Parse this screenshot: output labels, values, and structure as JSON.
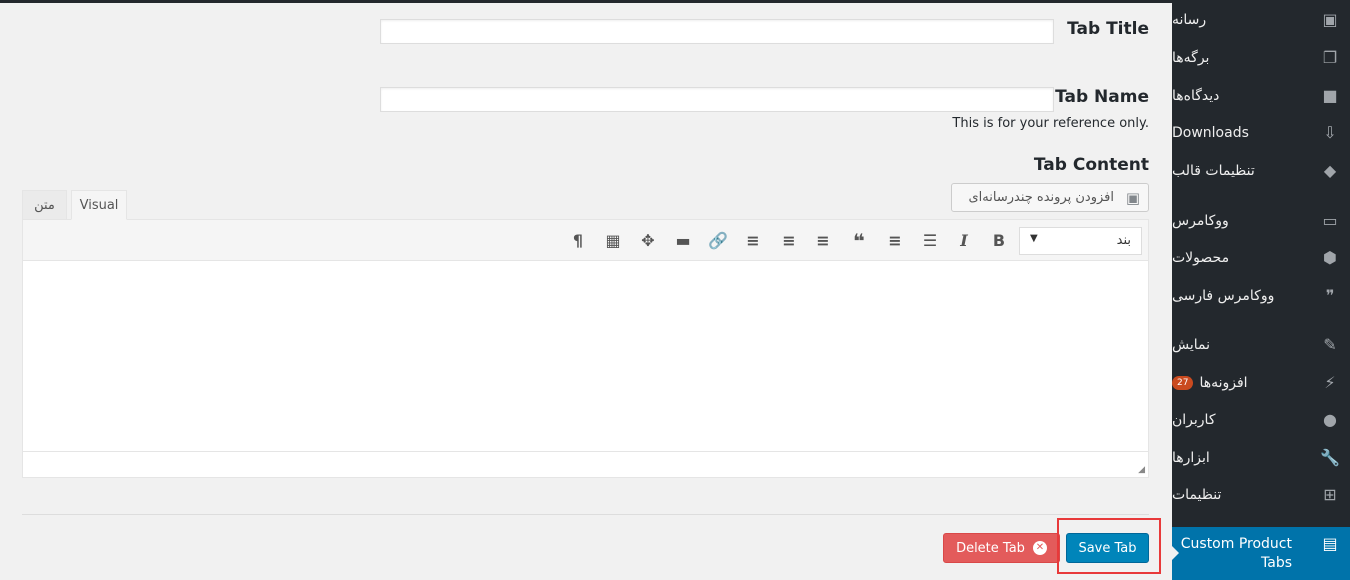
{
  "sidebar": {
    "items": [
      {
        "label": "رسانه",
        "icon": "media-icon"
      },
      {
        "label": "برگه‌ها",
        "icon": "pages-icon"
      },
      {
        "label": "دیدگاه‌ها",
        "icon": "comments-icon"
      },
      {
        "label": "Downloads",
        "icon": "download-icon"
      },
      {
        "label": "تنظیمات قالب",
        "icon": "theme-settings-icon"
      },
      {
        "label": "ووکامرس",
        "icon": "woo-icon"
      },
      {
        "label": "محصولات",
        "icon": "products-box-icon"
      },
      {
        "label": "ووکامرس فارسی",
        "icon": "woo-persian-icon"
      },
      {
        "label": "نمایش",
        "icon": "appearance-brush-icon"
      },
      {
        "label": "افزونه‌ها",
        "icon": "plugins-icon",
        "badge": "27"
      },
      {
        "label": "کاربران",
        "icon": "users-icon"
      },
      {
        "label": "ابزارها",
        "icon": "tools-wrench-icon"
      },
      {
        "label": "تنظیمات",
        "icon": "settings-icon"
      }
    ],
    "active": {
      "label": "Custom Product Tabs",
      "icon": "custom-tabs-icon"
    },
    "accent": "#0073aa"
  },
  "form": {
    "tab_title_label": "Tab Title",
    "tab_title_value": "",
    "tab_name_label": "Tab Name",
    "tab_name_value": "",
    "tab_name_help": "This is for your reference only.",
    "tab_content_label": "Tab Content",
    "add_media": "افزودن پرونده چندرسانه‌ای",
    "editor_tabs": {
      "visual": "Visual",
      "text": "متن"
    },
    "format_select": "بند"
  },
  "actions": {
    "delete": "Delete Tab",
    "save": "Save Tab",
    "delete_color": "#e35b5b",
    "save_color": "#0085ba"
  }
}
